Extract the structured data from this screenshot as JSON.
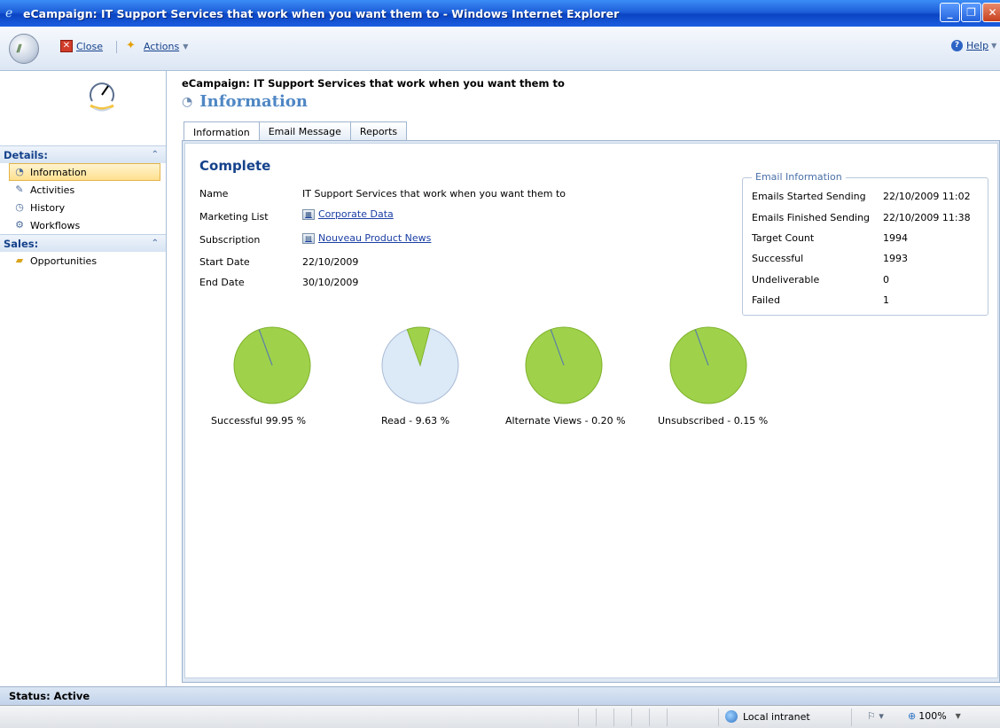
{
  "window": {
    "title": "eCampaign: IT Support Services that work when you want them to - Windows Internet Explorer"
  },
  "toolbar": {
    "close_label": "Close",
    "actions_label": "Actions",
    "help_label": "Help"
  },
  "sidebar": {
    "details_header": "Details:",
    "details_items": [
      {
        "label": "Information",
        "icon": "information-icon",
        "active": true
      },
      {
        "label": "Activities",
        "icon": "activities-icon"
      },
      {
        "label": "History",
        "icon": "history-icon"
      },
      {
        "label": "Workflows",
        "icon": "workflows-icon"
      }
    ],
    "sales_header": "Sales:",
    "sales_items": [
      {
        "label": "Opportunities",
        "icon": "opportunities-icon"
      }
    ]
  },
  "header": {
    "subtitle": "eCampaign: IT Support Services that work when you want them to",
    "title": "Information"
  },
  "tabs": [
    "Information",
    "Email Message",
    "Reports"
  ],
  "main": {
    "status_heading": "Complete",
    "fields": [
      {
        "label": "Name",
        "value": "IT Support Services that work when you want them to",
        "link": false
      },
      {
        "label": "Marketing List",
        "value": "Corporate Data",
        "link": true
      },
      {
        "label": "Subscription",
        "value": "Nouveau Product News",
        "link": true
      },
      {
        "label": "Start Date",
        "value": "22/10/2009",
        "link": false
      },
      {
        "label": "End Date",
        "value": "30/10/2009",
        "link": false
      }
    ]
  },
  "email_info": {
    "legend": "Email Information",
    "rows": [
      {
        "label": "Emails Started Sending",
        "value": "22/10/2009 11:02"
      },
      {
        "label": "Emails Finished Sending",
        "value": "22/10/2009 11:38"
      },
      {
        "label": "Target Count",
        "value": "1994"
      },
      {
        "label": "Successful",
        "value": "1993"
      },
      {
        "label": "Undeliverable",
        "value": "0"
      },
      {
        "label": "Failed",
        "value": "1"
      }
    ]
  },
  "chart_data": {
    "type": "pie",
    "pies": [
      {
        "label": "Successful 99.95 %",
        "percent": 99.95,
        "style": "success"
      },
      {
        "label": "Read - 9.63 %",
        "percent": 9.63,
        "style": "read"
      },
      {
        "label": "Alternate Views - 0.20 %",
        "percent": 0.2,
        "style": "success"
      },
      {
        "label": "Unsubscribed - 0.15 %",
        "percent": 0.15,
        "style": "success"
      }
    ],
    "colors": {
      "fill": "#9fd24a",
      "fill_dark": "#7fb22c",
      "empty": "#dce9f7",
      "line": "#5b7fa8"
    }
  },
  "status_bar": {
    "status": "Status: Active"
  },
  "ie_status": {
    "zone": "Local intranet",
    "zoom": "100%"
  }
}
